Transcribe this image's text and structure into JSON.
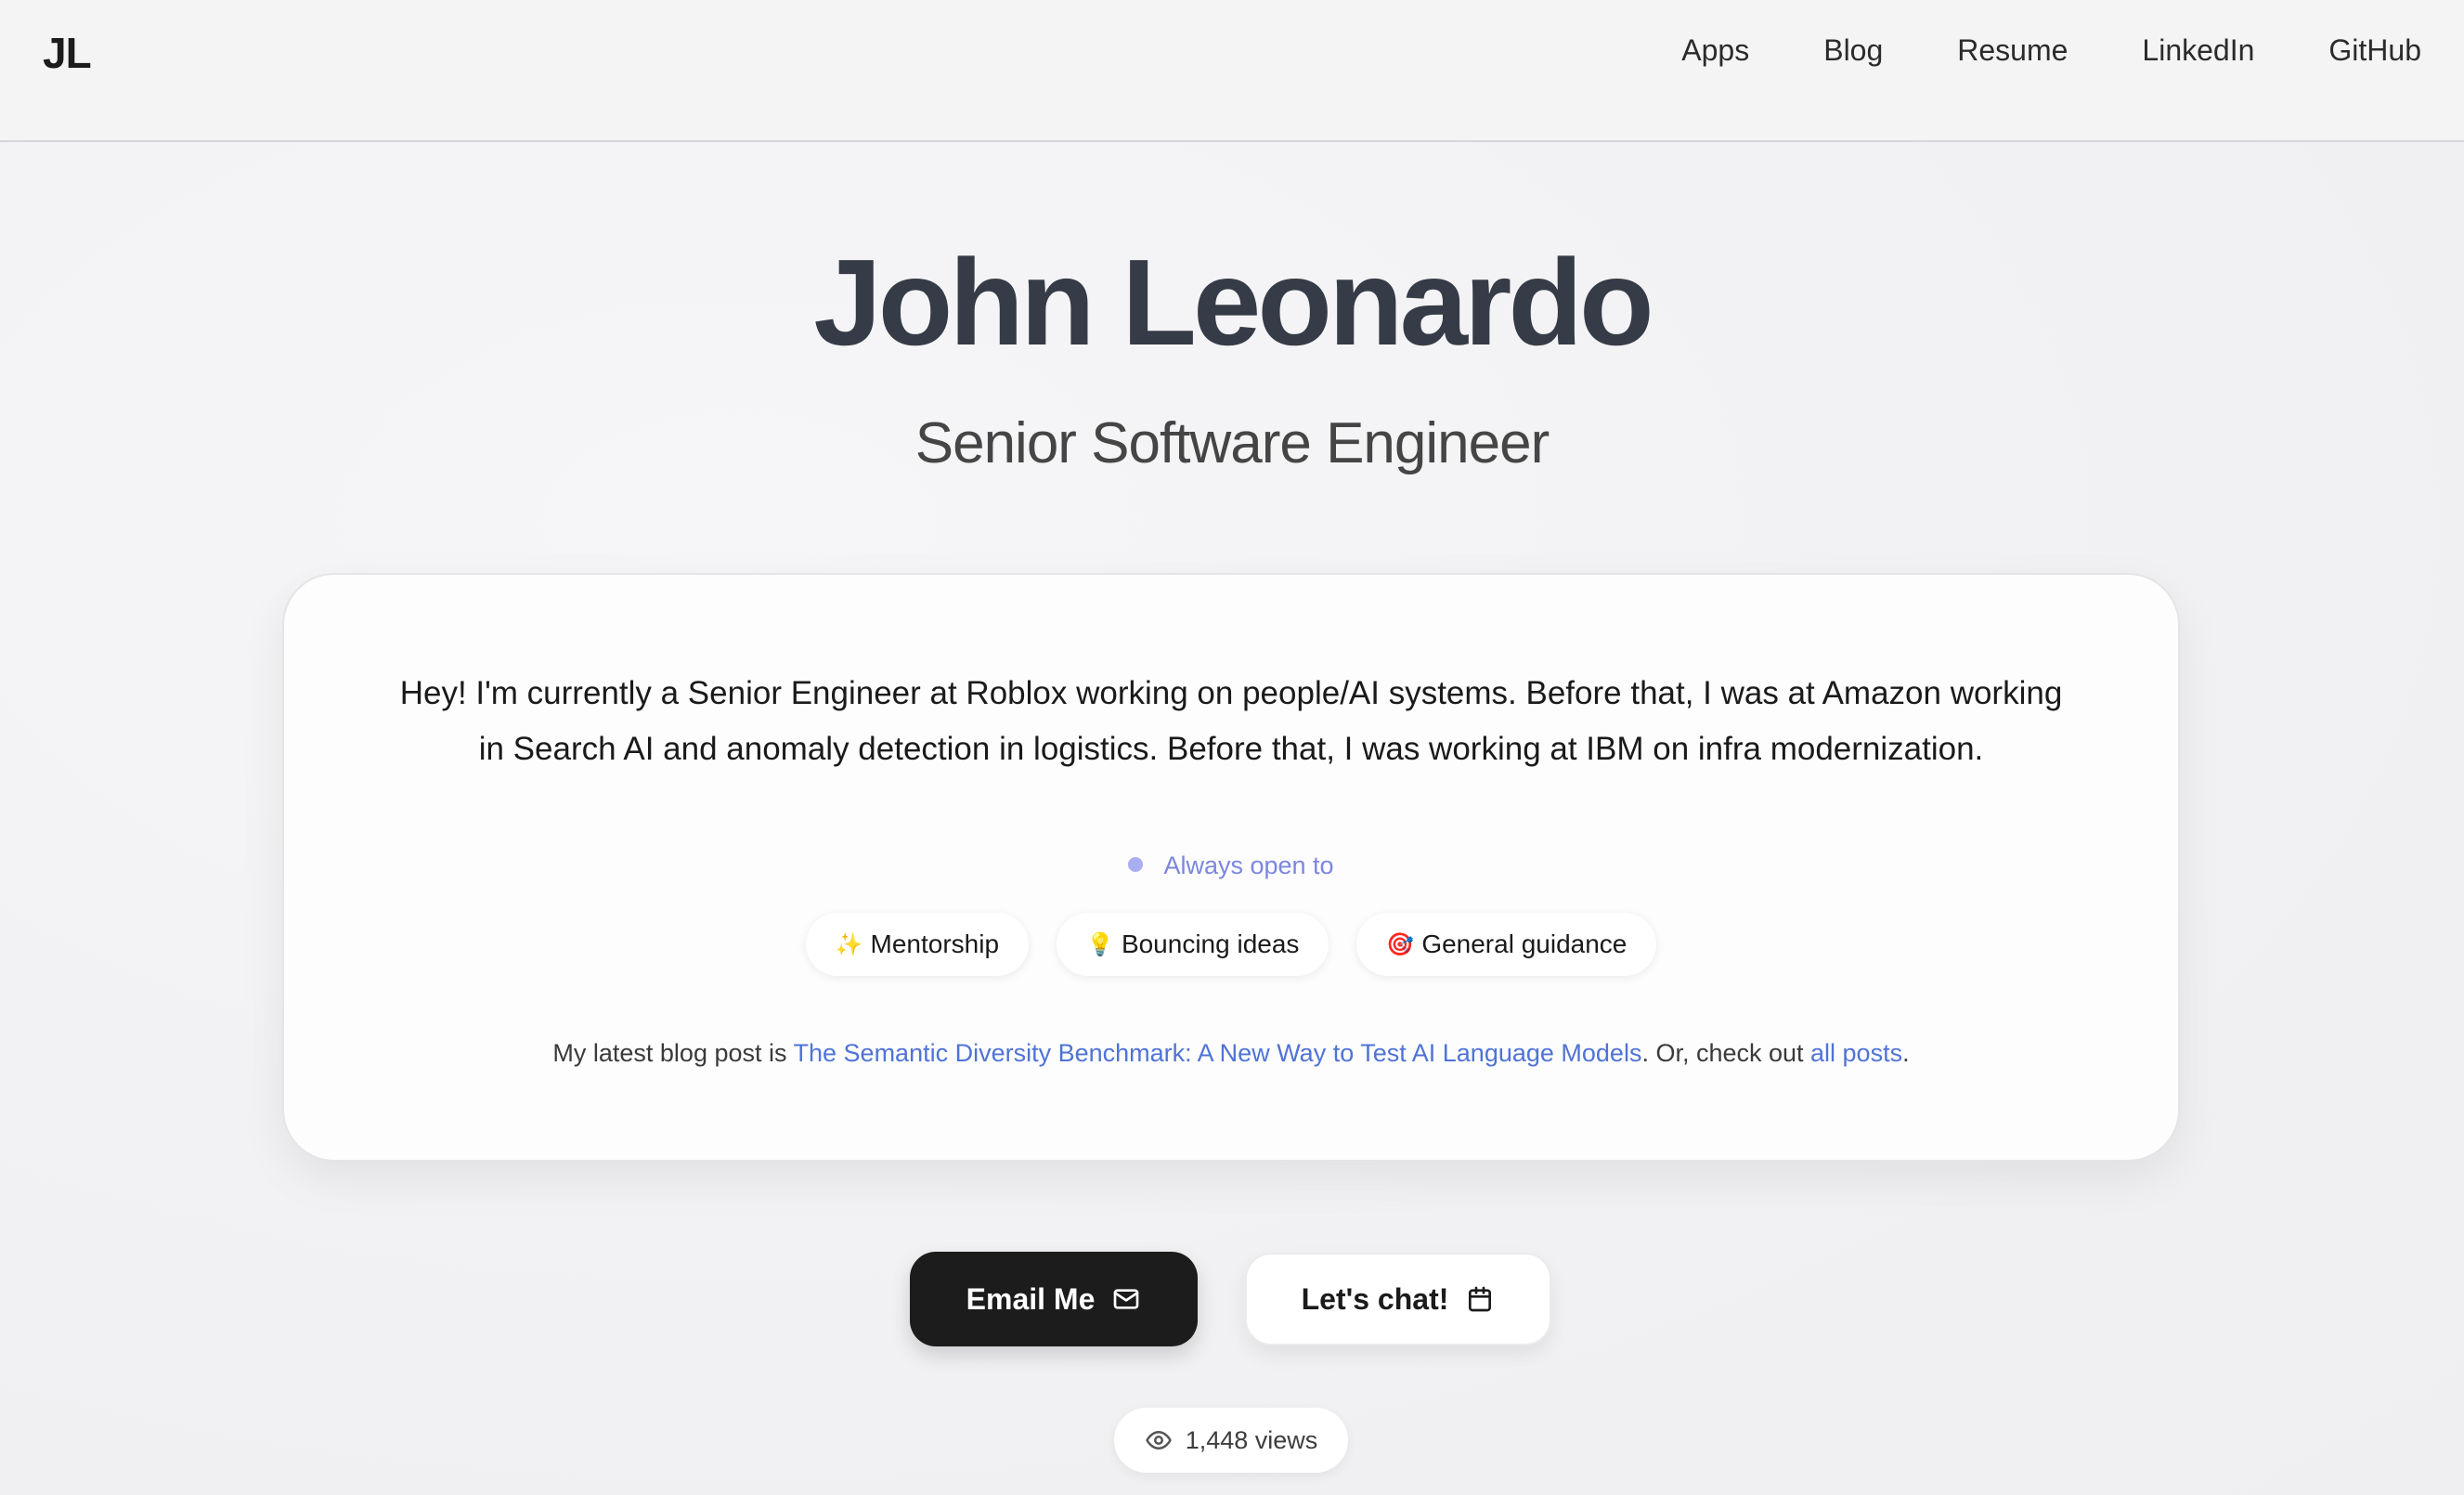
{
  "header": {
    "logo": "JL",
    "nav": [
      "Apps",
      "Blog",
      "Resume",
      "LinkedIn",
      "GitHub"
    ]
  },
  "hero": {
    "name": "John Leonardo",
    "title": "Senior Software Engineer"
  },
  "card": {
    "intro": "Hey! I'm currently a Senior Engineer at Roblox working on people/AI systems. Before that, I was at Amazon working in Search AI and anomaly detection in logistics. Before that, I was working at IBM on infra modernization.",
    "open_to_label": "Always open to",
    "tags": [
      {
        "emoji": "✨",
        "label": "Mentorship"
      },
      {
        "emoji": "💡",
        "label": "Bouncing ideas"
      },
      {
        "emoji": "🎯",
        "label": "General guidance"
      }
    ],
    "blog_prefix": "My latest blog post is ",
    "blog_link": "The Semantic Diversity Benchmark: A New Way to Test AI Language Models",
    "blog_middle": ". Or, check out ",
    "all_posts": "all posts",
    "blog_suffix": "."
  },
  "actions": {
    "email_label": "Email Me",
    "email_icon": "mail-icon",
    "chat_label": "Let's chat!",
    "chat_icon": "calendar-icon"
  },
  "views": {
    "icon": "eye-icon",
    "label": "1,448 views"
  },
  "colors": {
    "link": "#4f73d6",
    "accent": "#7b86e0",
    "primary_button": "#1b1c1b",
    "name": "#363c47"
  }
}
